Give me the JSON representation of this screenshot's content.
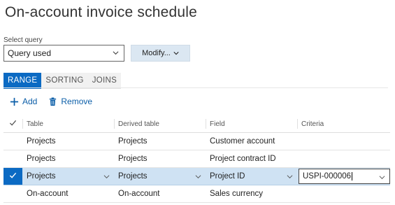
{
  "page": {
    "title": "On-account invoice schedule"
  },
  "query": {
    "label": "Select query",
    "value": "Query used",
    "modify_label": "Modify..."
  },
  "tabs": [
    {
      "label": "RANGE",
      "active": true
    },
    {
      "label": "SORTING",
      "active": false
    },
    {
      "label": "JOINS",
      "active": false
    }
  ],
  "actions": {
    "add_label": "Add",
    "remove_label": "Remove"
  },
  "grid": {
    "columns": [
      "Table",
      "Derived table",
      "Field",
      "Criteria"
    ],
    "rows": [
      {
        "table": "Projects",
        "derived": "Projects",
        "field": "Customer account",
        "criteria": ""
      },
      {
        "table": "Projects",
        "derived": "Projects",
        "field": "Project contract ID",
        "criteria": ""
      },
      {
        "table": "Projects",
        "derived": "Projects",
        "field": "Project ID",
        "criteria": "USPI-000006",
        "selected": true
      },
      {
        "table": "On-account",
        "derived": "On-account",
        "field": "Sales currency",
        "criteria": ""
      }
    ]
  },
  "colors": {
    "accent": "#0b6ac3",
    "selected_row": "#cfe2f3",
    "button_bg": "#dbe7f2",
    "link": "#0b5ea8"
  }
}
